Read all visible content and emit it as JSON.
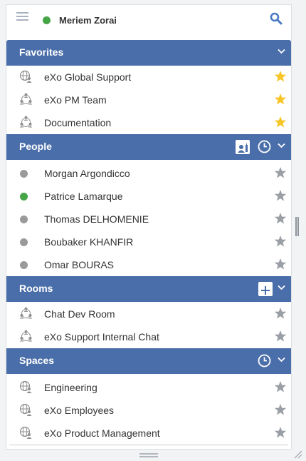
{
  "user": {
    "name": "Meriem Zorai",
    "status_color": "#46a546"
  },
  "colors": {
    "header_bg": "#4a6ea9",
    "star_active": "#f7c525",
    "star_inactive": "#9a9ea5",
    "offline": "#9a9a9a",
    "online": "#46a546"
  },
  "sections": {
    "favorites": {
      "title": "Favorites",
      "items": [
        {
          "label": "eXo Global Support",
          "icon": "globe-people-icon",
          "starred": true
        },
        {
          "label": "eXo PM Team",
          "icon": "group-icon",
          "starred": true
        },
        {
          "label": "Documentation",
          "icon": "group-icon",
          "starred": true
        }
      ]
    },
    "people": {
      "title": "People",
      "items": [
        {
          "label": "Morgan Argondicco",
          "status": "offline",
          "starred": false
        },
        {
          "label": "Patrice Lamarque",
          "status": "online",
          "starred": false
        },
        {
          "label": "Thomas DELHOMENIE",
          "status": "offline",
          "starred": false
        },
        {
          "label": "Boubaker KHANFIR",
          "status": "offline",
          "starred": false
        },
        {
          "label": "Omar BOURAS",
          "status": "offline",
          "starred": false
        }
      ]
    },
    "rooms": {
      "title": "Rooms",
      "items": [
        {
          "label": "Chat Dev Room",
          "icon": "group-icon",
          "starred": false
        },
        {
          "label": "eXo Support Internal Chat",
          "icon": "group-icon",
          "starred": false
        }
      ]
    },
    "spaces": {
      "title": "Spaces",
      "items": [
        {
          "label": "Engineering",
          "icon": "globe-people-icon",
          "starred": false
        },
        {
          "label": "eXo Employees",
          "icon": "globe-people-icon",
          "starred": false
        },
        {
          "label": "eXo Product Management",
          "icon": "globe-people-icon",
          "starred": false
        }
      ]
    }
  }
}
